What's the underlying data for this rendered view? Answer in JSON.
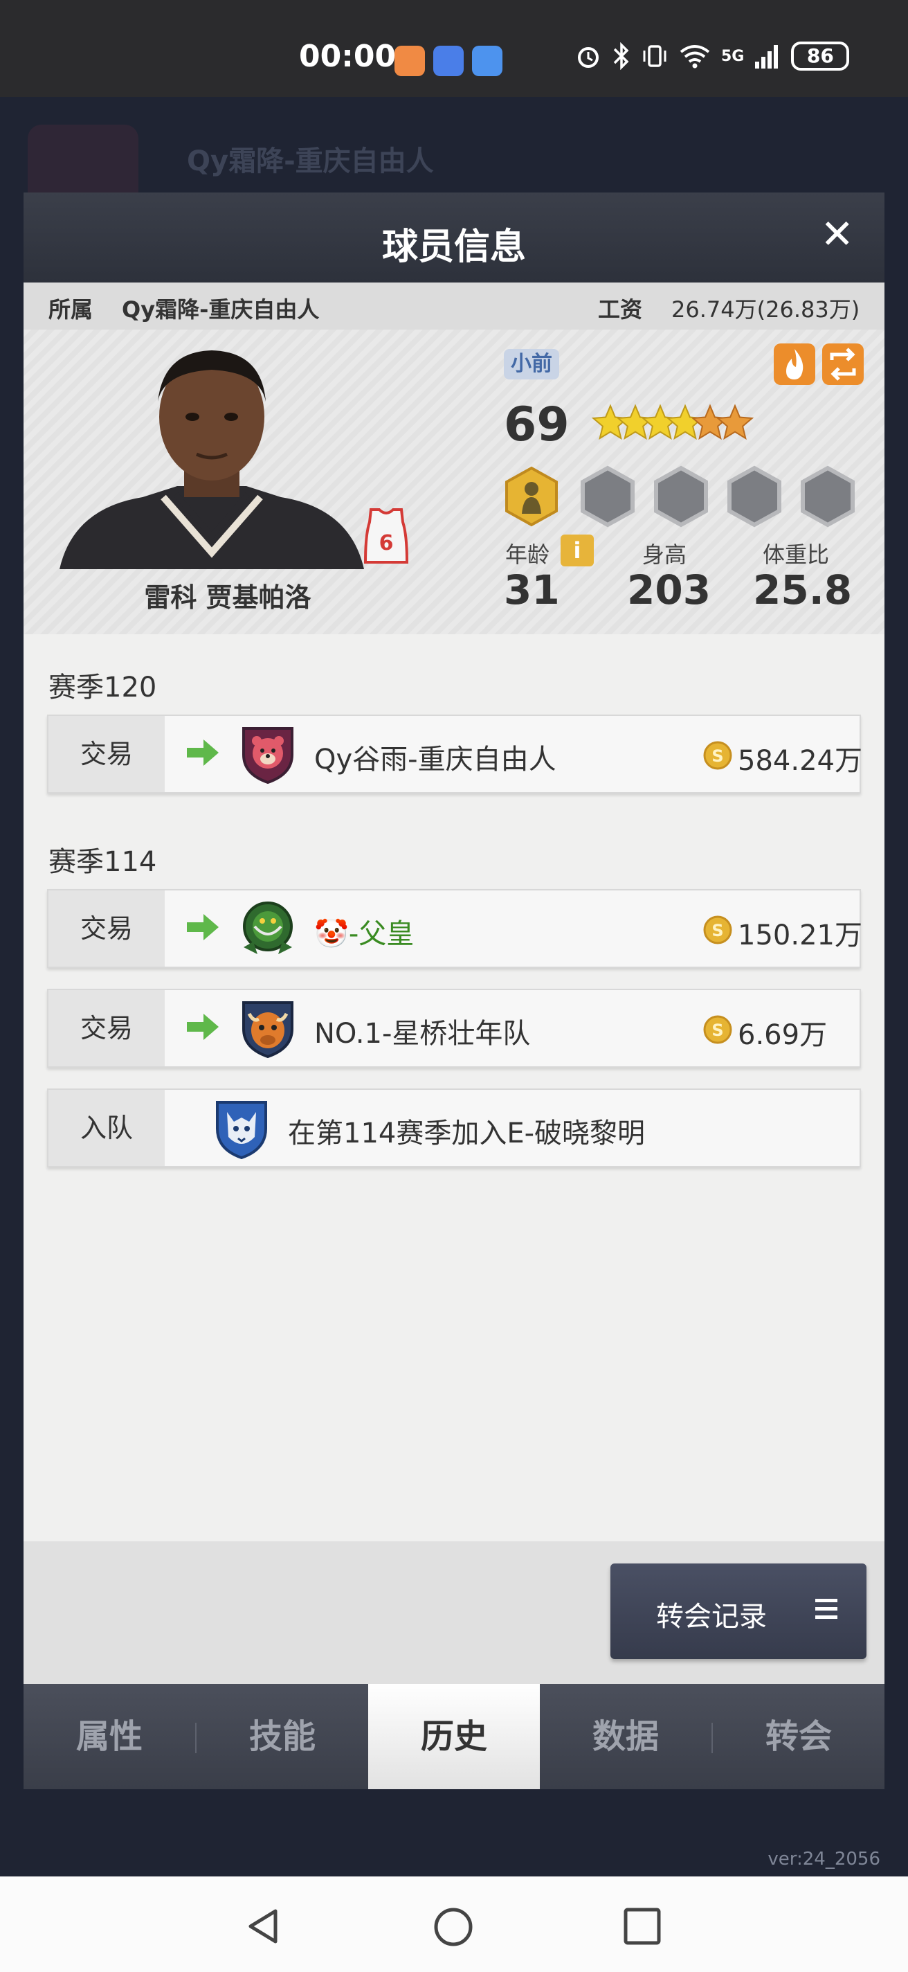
{
  "status_bar": {
    "time": "00:00",
    "battery": "86",
    "network": "5G",
    "icons": [
      "alarm-icon",
      "bluetooth-icon",
      "vibrate-icon",
      "wifi-icon",
      "signal-icon"
    ]
  },
  "background": {
    "team_name": "Qy霜降-重庆自由人",
    "version": "ver:24_2056"
  },
  "modal": {
    "title": "球员信息",
    "team_label": "所属",
    "team": "Qy霜降-重庆自由人",
    "salary_label": "工资",
    "salary": "26.74万(26.83万)"
  },
  "player": {
    "name": "雷科 贾基帕洛",
    "jersey_number": "6",
    "position": "小前",
    "overall": "69",
    "stars_filled": 4,
    "stars_half": 2,
    "age_label": "年龄",
    "age": "31",
    "height_label": "身高",
    "height": "203",
    "ratio_label": "体重比",
    "ratio": "25.8",
    "info_icon": "i"
  },
  "history": {
    "seasons": [
      {
        "label": "赛季120"
      },
      {
        "label": "赛季114"
      }
    ],
    "rows": [
      {
        "type": "交易",
        "team_prefix": "",
        "team": "Qy谷雨-重庆自由人",
        "amount": "584.24万"
      },
      {
        "type": "交易",
        "team_prefix": "🤡",
        "team": "-父皇",
        "amount": "150.21万",
        "team_color": "#3a8b22"
      },
      {
        "type": "交易",
        "team_prefix": "",
        "team": "NO.1-星桥壮年队",
        "amount": "6.69万"
      },
      {
        "type": "入队",
        "text": "在第114赛季加入E-破晓黎明"
      }
    ]
  },
  "actions": {
    "transfer_record": "转会记录"
  },
  "tabs": [
    {
      "label": "属性",
      "active": false
    },
    {
      "label": "技能",
      "active": false
    },
    {
      "label": "历史",
      "active": true
    },
    {
      "label": "数据",
      "active": false
    },
    {
      "label": "转会",
      "active": false
    }
  ],
  "colors": {
    "accent_orange": "#ec8d2b",
    "trade_arrow": "#5fb84a",
    "coin": "#e6b433"
  }
}
